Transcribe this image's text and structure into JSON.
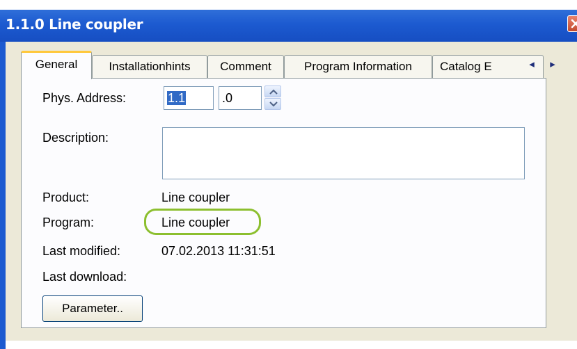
{
  "window": {
    "title": "1.1.0 Line coupler"
  },
  "tabs": [
    {
      "label": "General",
      "active": true
    },
    {
      "label": "Installationhints",
      "active": false
    },
    {
      "label": "Comment",
      "active": false
    },
    {
      "label": "Program Information",
      "active": false
    },
    {
      "label": "Catalog E",
      "active": false
    }
  ],
  "tab_scroll": {
    "left": "◂",
    "right": "▸"
  },
  "general": {
    "phys_address_label": "Phys. Address:",
    "phys_address_part1": "1.1",
    "phys_address_part2": ".0",
    "description_label": "Description:",
    "description_value": "",
    "product_label": "Product:",
    "product_value": "Line coupler",
    "program_label": "Program:",
    "program_value": "Line coupler",
    "last_modified_label": "Last modified:",
    "last_modified_value": "07.02.2013 11:31:51",
    "last_download_label": "Last download:",
    "last_download_value": "",
    "parameter_button": "Parameter.."
  },
  "colors": {
    "titlebar": "#1c5ad0",
    "highlight": "#8cbf2f",
    "active_tab_accent": "#ffc83c",
    "selection": "#316ac5"
  }
}
